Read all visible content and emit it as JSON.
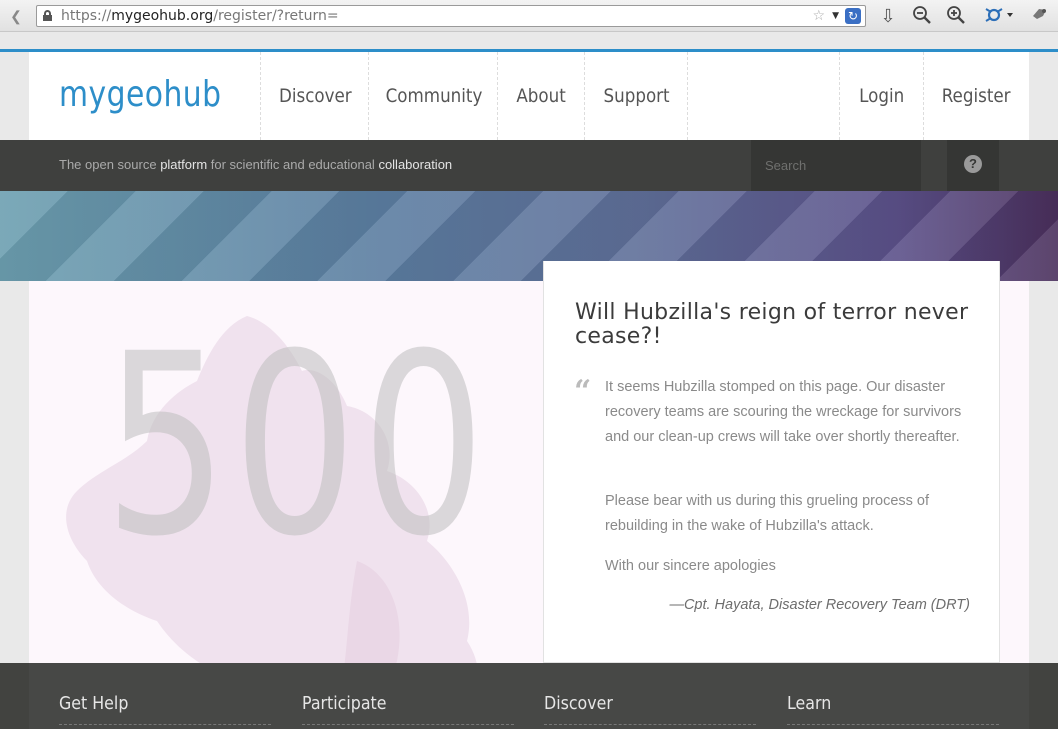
{
  "browser": {
    "url_prefix": "https://",
    "url_domain": "mygeohub.org",
    "url_path": "/register/?return="
  },
  "header": {
    "logo": "mygeohub",
    "nav": [
      "Discover",
      "Community",
      "About",
      "Support"
    ],
    "login": "Login",
    "register": "Register"
  },
  "tagline": {
    "part1": "The open source ",
    "word1": "platform",
    "part2": " for scientific and educational ",
    "word2": "collaboration"
  },
  "search": {
    "placeholder": "Search"
  },
  "error": {
    "code": "500",
    "title": "Will Hubzilla's reign of terror never cease?!",
    "paragraphs": [
      "It seems Hubzilla stomped on this page. Our disaster recovery teams are scouring the wreckage for survivors and our clean-up crews will take over shortly thereafter.",
      "Please bear with us during this grueling process of rebuilding in the wake of Hubzilla's attack.",
      "With our sincere apologies"
    ],
    "signature": "—Cpt. Hayata, Disaster Recovery Team (DRT)"
  },
  "footer": {
    "columns": [
      "Get Help",
      "Participate",
      "Discover",
      "Learn"
    ]
  },
  "colors": {
    "accent": "#2d8ec9",
    "bar": "#3f403e"
  }
}
